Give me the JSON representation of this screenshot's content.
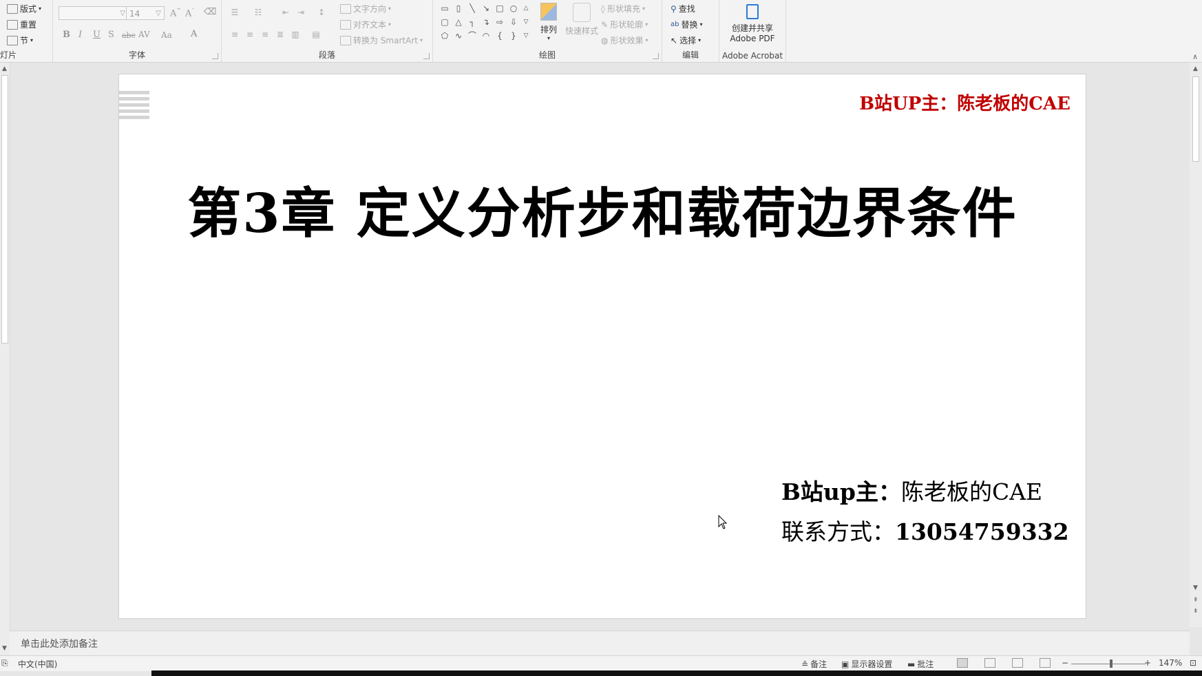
{
  "ribbon": {
    "slides_group": {
      "label": "灯片",
      "layout": "版式",
      "reset": "重置",
      "section": "节"
    },
    "font_group": {
      "label": "字体",
      "font_name": "",
      "font_size": "14",
      "bold": "B",
      "italic": "I",
      "underline": "U",
      "shadow": "S",
      "strike": "abc",
      "spacing": "AV",
      "case": "Aa",
      "color": "A"
    },
    "paragraph_group": {
      "label": "段落",
      "text_direction": "文字方向",
      "align_text": "对齐文本",
      "convert_smartart": "转换为 SmartArt"
    },
    "drawing_group": {
      "label": "绘图",
      "arrange": "排列",
      "quick_styles": "快速样式",
      "shape_fill": "形状填充",
      "shape_outline": "形状轮廓",
      "shape_effects": "形状效果"
    },
    "editing_group": {
      "label": "编辑",
      "find": "查找",
      "replace": "替换",
      "select": "选择"
    },
    "acrobat_group": {
      "label": "Adobe Acrobat",
      "create_line1": "创建并共享",
      "create_line2": "Adobe PDF"
    }
  },
  "slide": {
    "watermark": "B站UP主：陈老板的CAE",
    "title": "第3章 定义分析步和载荷边界条件",
    "author_label": "B站up主：",
    "author_name": "陈老板的CAE",
    "contact_label": "联系方式：",
    "contact_number": "13054759332"
  },
  "notes": {
    "placeholder": "单击此处添加备注"
  },
  "status": {
    "language": "中文(中国)",
    "notes": "备注",
    "display_settings": "显示器设置",
    "comments": "批注",
    "zoom": "147%"
  }
}
